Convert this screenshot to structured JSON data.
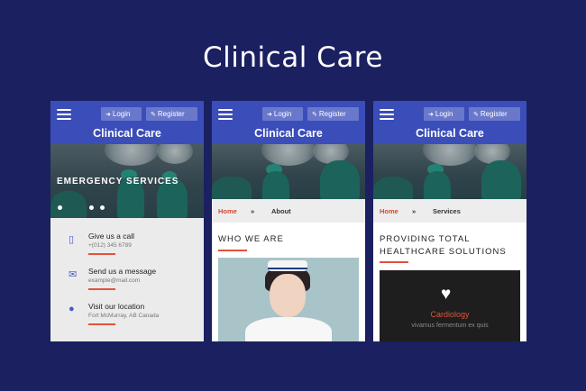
{
  "page_title": "Clinical Care",
  "header": {
    "app_title": "Clinical Care",
    "login_label": "Login",
    "register_label": "Register"
  },
  "phone1": {
    "hero_caption": "EMERGENCY SERVICES",
    "contact": [
      {
        "icon": "phone-icon",
        "label": "Give us a call",
        "value": "+(012) 345 6789"
      },
      {
        "icon": "envelope-icon",
        "label": "Send us a message",
        "value": "example@mail.com"
      },
      {
        "icon": "map-marker-icon",
        "label": "Visit our location",
        "value": "Fort McMurray, AB Canada"
      }
    ]
  },
  "phone2": {
    "breadcrumb": {
      "home": "Home",
      "separator": "»",
      "current": "About"
    },
    "section_heading": "WHO WE ARE"
  },
  "phone3": {
    "breadcrumb": {
      "home": "Home",
      "separator": "»",
      "current": "Services"
    },
    "section_heading_line1": "PROVIDING TOTAL",
    "section_heading_line2": "HEALTHCARE SOLUTIONS",
    "card_title": "Cardiology",
    "card_text": "vivamus fermentum ex quis"
  },
  "colors": {
    "background": "#1b2060",
    "header": "#3b4db8",
    "accent": "#e0533a"
  }
}
